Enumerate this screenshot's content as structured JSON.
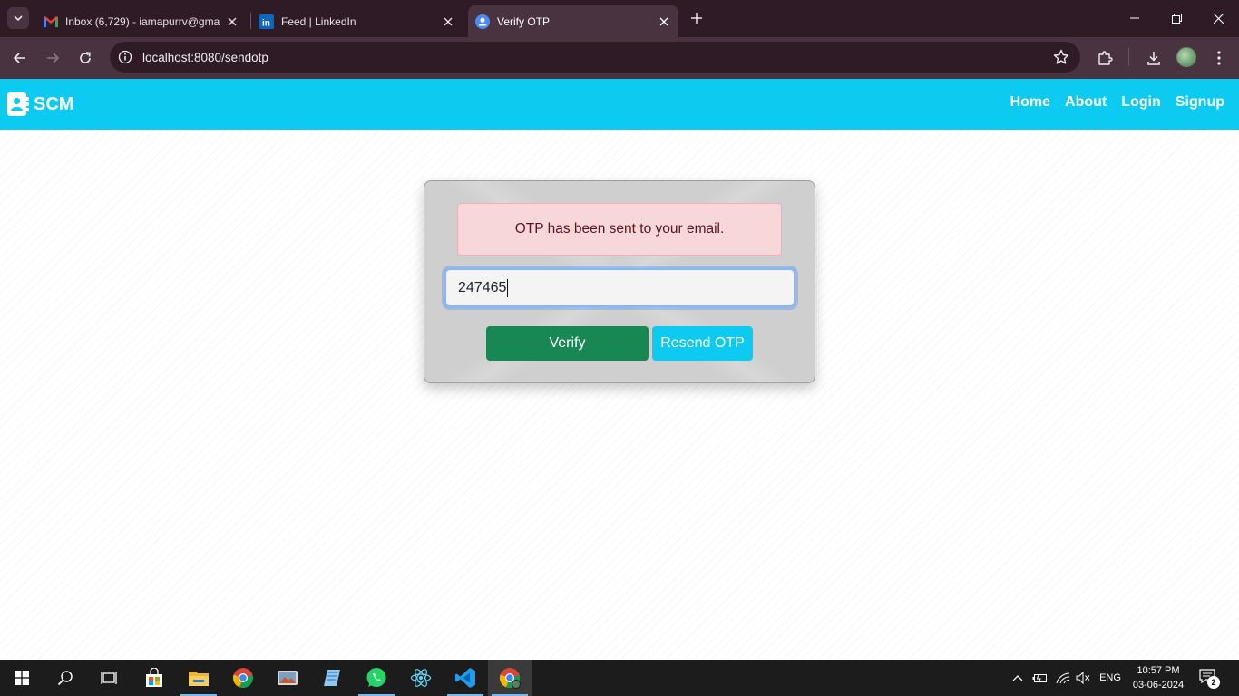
{
  "browser": {
    "tabs": [
      {
        "title": "Inbox (6,729) - iamapurrv@gma",
        "favicon": "gmail-icon"
      },
      {
        "title": "Feed | LinkedIn",
        "favicon": "linkedin-icon"
      },
      {
        "title": "Verify OTP",
        "favicon": "scm-icon",
        "active": true
      }
    ],
    "url": "localhost:8080/sendotp"
  },
  "app": {
    "brand": "SCM",
    "nav": {
      "home": "Home",
      "about": "About",
      "login": "Login",
      "signup": "Signup"
    },
    "colors": {
      "navbar": "#0dcaf0",
      "verify": "#198754",
      "resend": "#0dcaf0",
      "alert_bg": "#f8d7da"
    }
  },
  "otp_card": {
    "alert": "OTP has been sent to your email.",
    "otp_value": "247465",
    "verify_label": "Verify",
    "resend_label": "Resend OTP"
  },
  "taskbar": {
    "apps": [
      "start-icon",
      "search-icon",
      "task-view-icon",
      "store-icon",
      "file-explorer-icon",
      "chrome-icon",
      "photos-icon",
      "notepad-icon",
      "whatsapp-icon",
      "react-devtools-icon",
      "vscode-icon",
      "chrome-profile-icon"
    ],
    "lang": "ENG",
    "time": "10:57 PM",
    "date": "03-06-2024",
    "notifications": "2"
  }
}
